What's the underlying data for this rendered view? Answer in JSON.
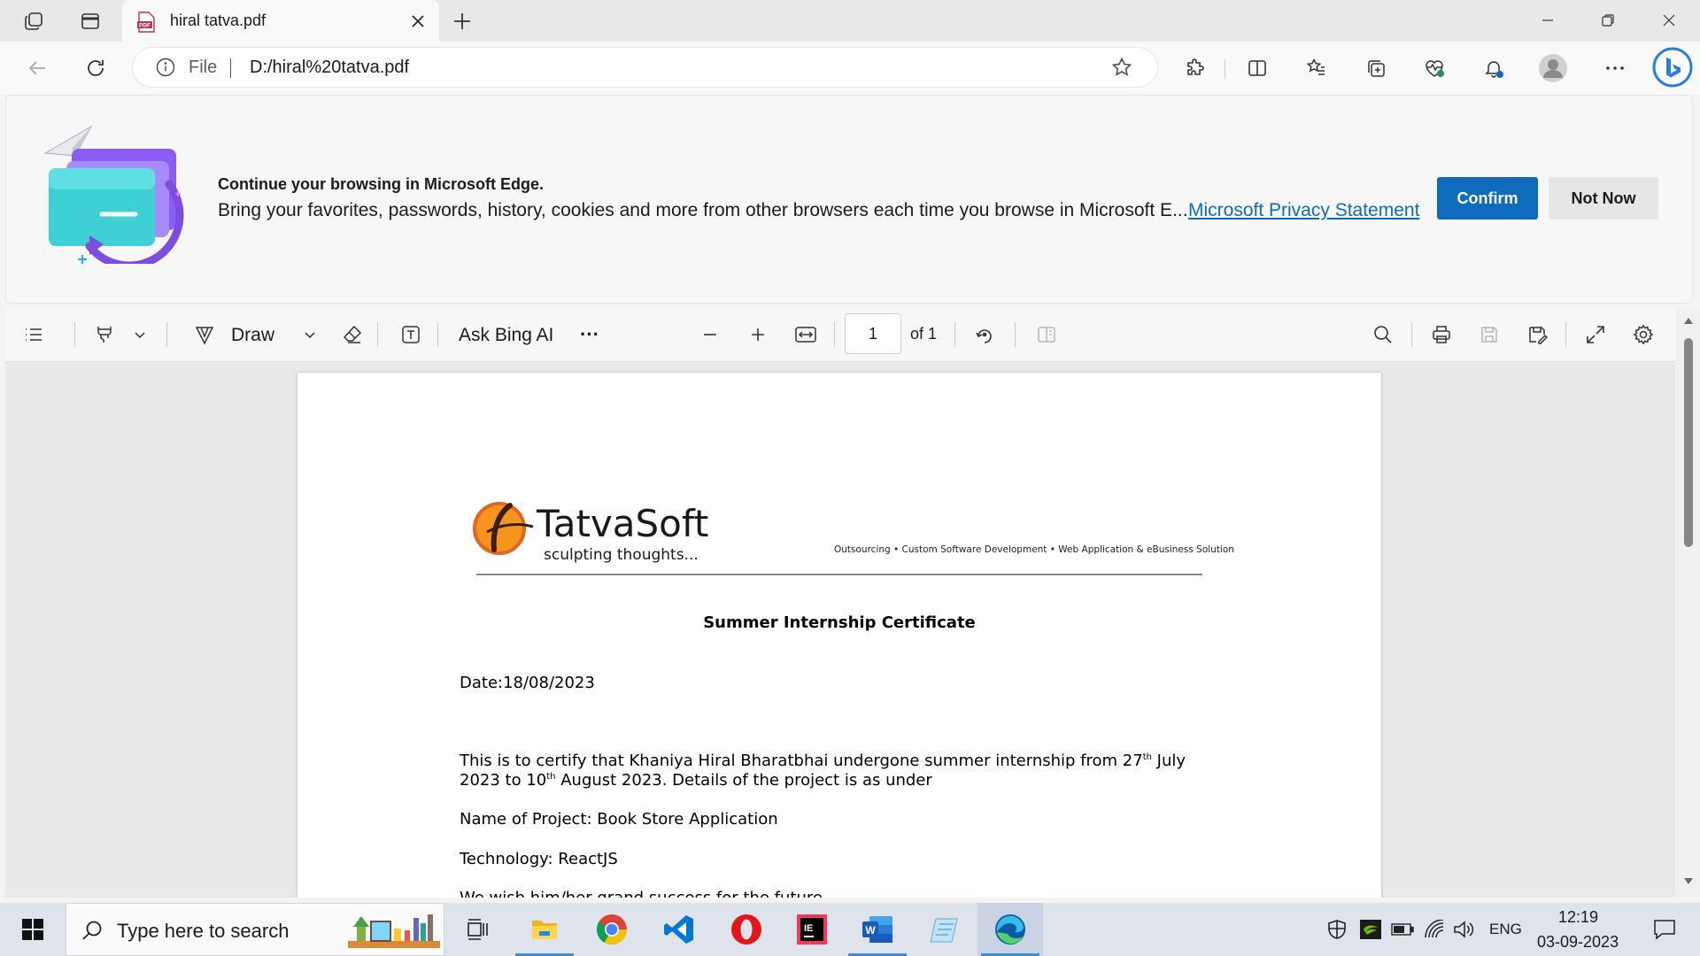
{
  "browser": {
    "tab": {
      "title": "hiral tatva.pdf",
      "icon": "pdf-icon"
    },
    "address": {
      "scheme_label": "File",
      "url": "D:/hiral%20tatva.pdf"
    }
  },
  "banner": {
    "title": "Continue your browsing in Microsoft Edge.",
    "text": "Bring your favorites, passwords, history, cookies and more from other browsers each time you browse in Microsoft E...",
    "link": "Microsoft Privacy Statement",
    "confirm_label": "Confirm",
    "notnow_label": "Not Now"
  },
  "pdf_toolbar": {
    "draw_label": "Draw",
    "ask_bing_label": "Ask Bing AI",
    "more_label": "···",
    "page_current": "1",
    "page_total_label": "of 1"
  },
  "document": {
    "logo_name": "TatvaSoft",
    "logo_tagline": "sculpting thoughts...",
    "header_tagline": "Outsourcing • Custom Software Development • Web Application & eBusiness Solution",
    "title": "Summer Internship Certificate",
    "date": "Date:18/08/2023",
    "para_a": "This is to certify that Khaniya Hiral Bharatbhai  undergone summer internship from 27",
    "para_sup1": "th",
    "para_b": " July",
    "para_c": "2023 to 10",
    "para_sup2": "th",
    "para_d": " August 2023. Details of the project is as under",
    "project": "Name of Project: Book Store Application",
    "technology": "Technology: ReactJS",
    "wish": "We wish him/her grand success for the future."
  },
  "taskbar": {
    "search_placeholder": "Type here to search",
    "language": "ENG",
    "time": "12:19",
    "date": "03-09-2023"
  },
  "colors": {
    "accent": "#0f6cbd",
    "taskbar": "#dfe3ec",
    "page_bg": "#e9e9e9"
  }
}
